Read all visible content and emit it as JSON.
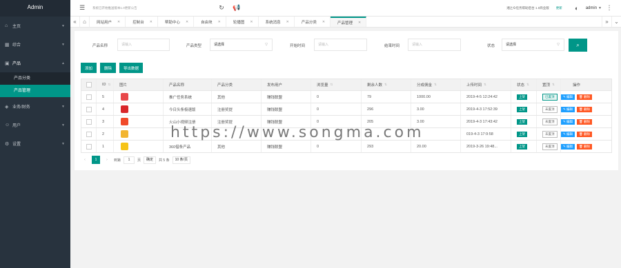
{
  "app": {
    "title": "Admin"
  },
  "sidebar": {
    "items": [
      {
        "label": "主页",
        "icon": "home-icon"
      },
      {
        "label": "综合",
        "icon": "grid-icon"
      },
      {
        "label": "产品",
        "icon": "product-icon",
        "expanded": true,
        "children": [
          {
            "label": "产品分类"
          },
          {
            "label": "产品管理",
            "active": true
          }
        ]
      },
      {
        "label": "业务/财务",
        "icon": "finance-icon"
      },
      {
        "label": "用户",
        "icon": "user-icon"
      },
      {
        "label": "设置",
        "icon": "gear-icon"
      }
    ]
  },
  "topbar": {
    "notice": "系统已开始推送版本1.0更新公告",
    "version_text": "湘之众任务帮助后台 1.0商业版",
    "update_label": "更新",
    "user": "admin"
  },
  "tabs": [
    {
      "label": "网站用户"
    },
    {
      "label": "控制台"
    },
    {
      "label": "帮助中心"
    },
    {
      "label": "自由块"
    },
    {
      "label": "轮播图"
    },
    {
      "label": "系统消息"
    },
    {
      "label": "产品分类"
    },
    {
      "label": "产品管理",
      "active": true
    }
  ],
  "search": {
    "name_label": "产品名称",
    "name_placeholder": "请输入",
    "type_label": "产品类型",
    "type_value": "请选择",
    "start_label": "开始时间",
    "start_placeholder": "请输入",
    "end_label": "结束时间",
    "end_placeholder": "请输入",
    "status_label": "状态",
    "status_value": "请选择"
  },
  "actions": {
    "add": "添加",
    "delete": "删除",
    "export": "导出数据"
  },
  "table": {
    "headers": [
      "ID",
      "图片",
      "产品名称",
      "产品分类",
      "发布用户",
      "浏览量",
      "剩余人数",
      "分成佣金",
      "上传时间",
      "状态",
      "置顶",
      "操作"
    ],
    "rows": [
      {
        "id": "5",
        "thumb_color": "#e8484a",
        "name": "推广任务系统",
        "category": "其他",
        "user": "赚钱联盟",
        "views": "0",
        "remaining": "79",
        "commission": "1000.00",
        "time": "2019-4-5 12:24:42",
        "status": "上架",
        "top": "已置顶",
        "top_on": true
      },
      {
        "id": "4",
        "thumb_color": "#d9262a",
        "name": "今日头条极速版",
        "category": "注册奖提",
        "user": "赚钱联盟",
        "views": "0",
        "remaining": "296",
        "commission": "3.00",
        "time": "2019-4-3 17:52:39",
        "status": "上架",
        "top": "未置顶",
        "top_on": false
      },
      {
        "id": "3",
        "thumb_color": "#f04a2a",
        "name": "火山小视频注册",
        "category": "注册奖提",
        "user": "赚钱联盟",
        "views": "0",
        "remaining": "205",
        "commission": "3.00",
        "time": "2019-4-3 17:43:42",
        "status": "上架",
        "top": "未置顶",
        "top_on": false
      },
      {
        "id": "2",
        "thumb_color": "#f2b530",
        "name": "",
        "category": "",
        "user": "",
        "views": "",
        "remaining": "",
        "commission": "",
        "time": "019-4-3 17:9:58",
        "status": "上架",
        "top": "未置顶",
        "top_on": false
      },
      {
        "id": "1",
        "thumb_color": "#f6c417",
        "name": "360借条产品",
        "category": "其他",
        "user": "赚钱联盟",
        "views": "0",
        "remaining": "293",
        "commission": "20.00",
        "time": "2019-3-26 19:48...",
        "status": "上架",
        "top": "未置顶",
        "top_on": false
      }
    ],
    "edit_label": "编辑",
    "delete_label": "删除"
  },
  "pager": {
    "current": "1",
    "goto_label": "到第",
    "goto_value": "1",
    "page_label": "页",
    "confirm": "确定",
    "total": "共 5 条",
    "size": "10 条/页"
  },
  "watermark": "https://www.songma.com"
}
